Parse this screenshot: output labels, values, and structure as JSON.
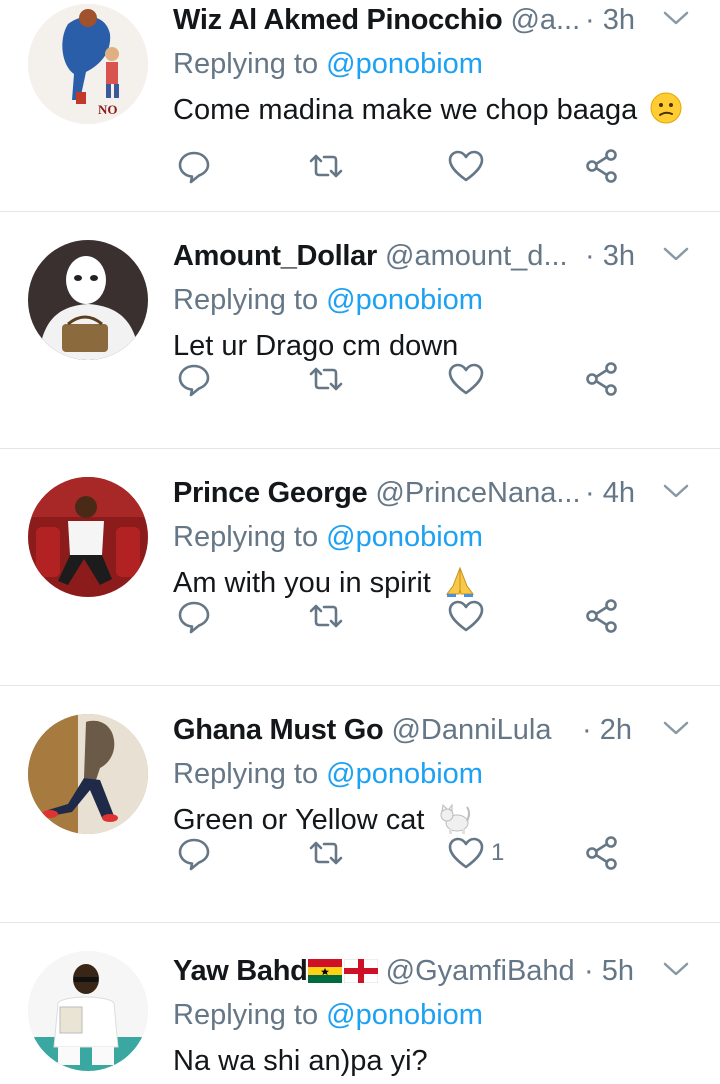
{
  "replying_prefix": "Replying to",
  "tweets": [
    {
      "name": "Wiz Al Akmed Pinocchio",
      "handle": "@a...",
      "time": "· 3h",
      "mention": "@ponobiom",
      "text": "Come madina make we chop baaga",
      "emoji": "confused-face-emoji",
      "avatar_text": "NO",
      "likes": ""
    },
    {
      "name": "Amount_Dollar",
      "handle": "@amount_d...",
      "time": "· 3h",
      "mention": "@ponobiom",
      "text": "Let ur Drago cm down",
      "emoji": "",
      "likes": ""
    },
    {
      "name": "Prince George",
      "handle": "@PrinceNana...",
      "time": "· 4h",
      "mention": "@ponobiom",
      "text": "Am with you in spirit",
      "emoji": "folded-hands-emoji",
      "likes": ""
    },
    {
      "name": "Ghana Must Go",
      "handle": "@DanniLula",
      "time": "· 2h",
      "mention": "@ponobiom",
      "text": "Green or Yellow cat",
      "emoji": "cat-emoji",
      "likes": "1"
    },
    {
      "name": "Yaw Bahd",
      "name_flags": "ghana-flag-emoji england-flag-emoji",
      "handle": "@GyamfiBahd",
      "time": "· 5h",
      "mention": "@ponobiom",
      "text": "Na wa shi an)pa yi?",
      "emoji": "",
      "likes": ""
    }
  ],
  "colors": {
    "accent": "#1da1f2",
    "muted": "#657786",
    "text": "#14171a",
    "divider": "#e1e8ed"
  }
}
